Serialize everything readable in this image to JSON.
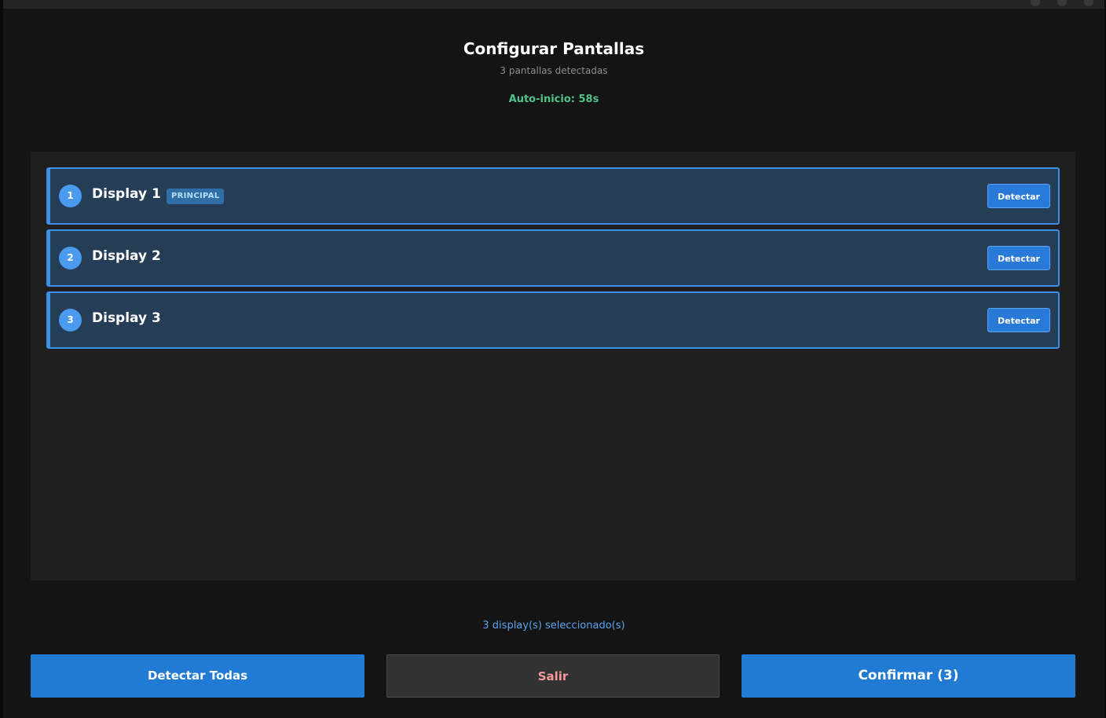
{
  "header": {
    "title": "Configurar Pantallas",
    "subtitle": "3 pantallas detectadas",
    "auto_start": "Auto-inicio: 58s"
  },
  "displays": [
    {
      "number": "1",
      "name": "Display 1",
      "badge": "PRINCIPAL",
      "detect_label": "Detectar"
    },
    {
      "number": "2",
      "name": "Display 2",
      "detect_label": "Detectar"
    },
    {
      "number": "3",
      "name": "Display 3",
      "detect_label": "Detectar"
    }
  ],
  "status": {
    "selected": "3 display(s) seleccionado(s)"
  },
  "footer": {
    "detect_all_label": "Detectar Todas",
    "exit_label": "Salir",
    "confirm_label": "Confirmar (3)"
  },
  "colors": {
    "accent": "#217ad4",
    "row_bg": "#253d57",
    "row_border": "#3d8fe6",
    "countdown": "#4fc38a",
    "exit_text": "#f49a9a"
  }
}
